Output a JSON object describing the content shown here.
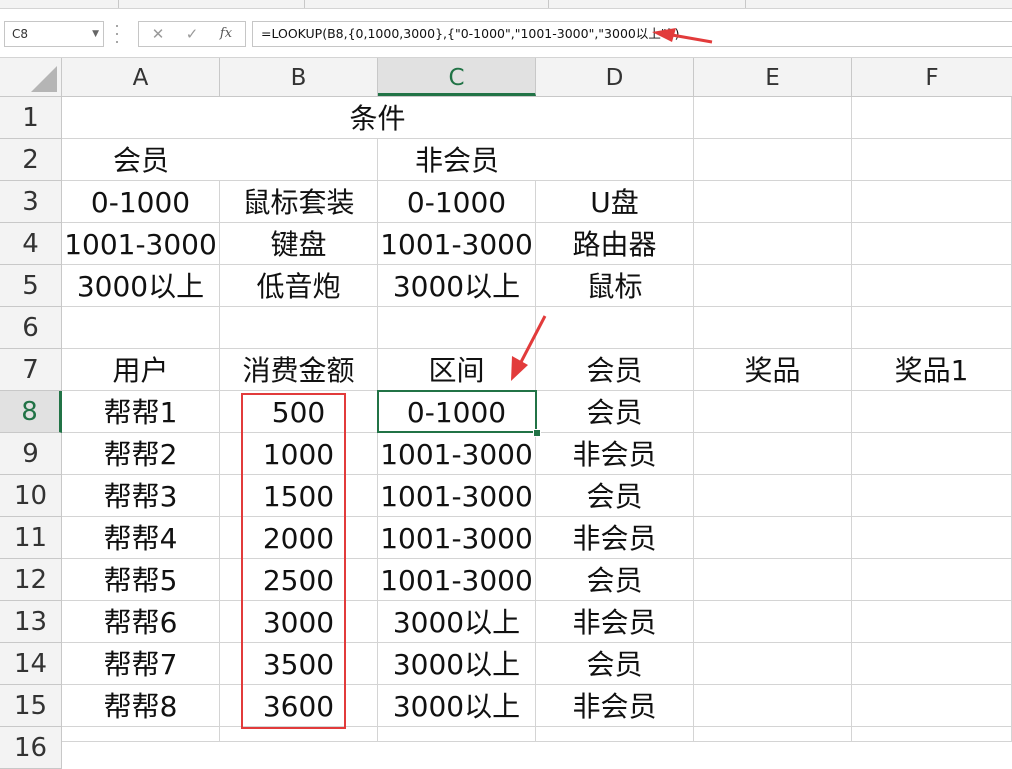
{
  "formula_bar": {
    "name_box": "C8",
    "formula": "=LOOKUP(B8,{0,1000,3000},{\"0-1000\",\"1001-3000\",\"3000以上\"})",
    "cancel_icon": "✕",
    "enter_icon": "✓",
    "fx_label": "fx"
  },
  "columns": [
    "A",
    "B",
    "C",
    "D",
    "E",
    "F"
  ],
  "selected_column": "C",
  "rows": [
    "1",
    "2",
    "3",
    "4",
    "5",
    "6",
    "7",
    "8",
    "9",
    "10",
    "11",
    "12",
    "13",
    "14",
    "15",
    "16"
  ],
  "selected_row": "8",
  "selected_cell": "C8",
  "cells": {
    "title": "条件",
    "row2": [
      "会员",
      "",
      "非会员",
      ""
    ],
    "row3": [
      "0-1000",
      "鼠标套装",
      "0-1000",
      "U盘"
    ],
    "row4": [
      "1001-3000",
      "键盘",
      "1001-3000",
      "路由器"
    ],
    "row5": [
      "3000以上",
      "低音炮",
      "3000以上",
      "鼠标"
    ],
    "row7": [
      "用户",
      "消费金额",
      "区间",
      "会员",
      "奖品",
      "奖品1"
    ],
    "data": [
      [
        "帮帮1",
        "500",
        "0-1000",
        "会员"
      ],
      [
        "帮帮2",
        "1000",
        "1001-3000",
        "非会员"
      ],
      [
        "帮帮3",
        "1500",
        "1001-3000",
        "会员"
      ],
      [
        "帮帮4",
        "2000",
        "1001-3000",
        "非会员"
      ],
      [
        "帮帮5",
        "2500",
        "1001-3000",
        "会员"
      ],
      [
        "帮帮6",
        "3000",
        "3000以上",
        "非会员"
      ],
      [
        "帮帮7",
        "3500",
        "3000以上",
        "会员"
      ],
      [
        "帮帮8",
        "3600",
        "3000以上",
        "非会员"
      ]
    ]
  },
  "colors": {
    "accent": "#217346",
    "annotation": "#e23b3b",
    "header_bg": "#f3f3f3"
  }
}
